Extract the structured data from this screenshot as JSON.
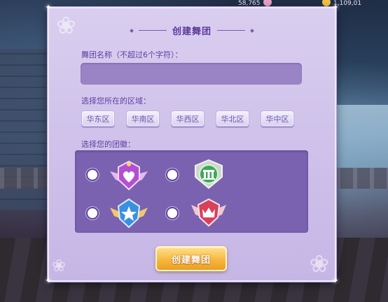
{
  "hud": {
    "currency_1": "58,765",
    "currency_2": "1,109,01"
  },
  "dialog": {
    "title": "创建舞团",
    "name_label": "舞团名称（不超过6个字符）：",
    "name_value": "",
    "region_label": "选择您所在的区域：",
    "regions": [
      "华东区",
      "华南区",
      "华西区",
      "华北区",
      "华中区"
    ],
    "emblem_label": "选择您的团徽：",
    "emblems": [
      {
        "icon": "heart-wings-emblem",
        "color": "#c45ad8"
      },
      {
        "icon": "column-emblem",
        "color": "#3ea85a"
      },
      {
        "icon": "star-shield-emblem",
        "color": "#3b8fe0"
      },
      {
        "icon": "crown-wings-emblem",
        "color": "#d9405a"
      }
    ],
    "create_button": "创建舞团"
  },
  "colors": {
    "panel": "#d6cbee",
    "accent": "#5b3a9c",
    "button": "#f6b840"
  }
}
